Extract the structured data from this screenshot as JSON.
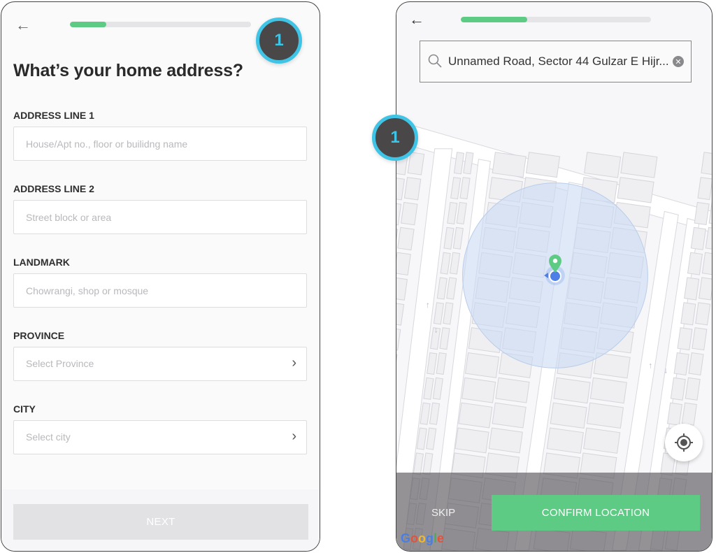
{
  "left_screen": {
    "progress_percent": 20,
    "title": "What’s your home address?",
    "fields": [
      {
        "label": "ADDRESS LINE 1",
        "placeholder": "House/Apt no., floor or builidng name",
        "type": "text"
      },
      {
        "label": "ADDRESS LINE 2",
        "placeholder": "Street block or area",
        "type": "text"
      },
      {
        "label": "LANDMARK",
        "placeholder": "Chowrangi, shop or mosque",
        "type": "text"
      },
      {
        "label": "PROVINCE",
        "placeholder": "Select Province",
        "type": "select"
      },
      {
        "label": "CITY",
        "placeholder": "Select city",
        "type": "select"
      }
    ],
    "next_label": "NEXT",
    "badge": "1"
  },
  "right_screen": {
    "progress_percent": 35,
    "search_value": "Unnamed Road, Sector 44 Gulzar E Hijr...",
    "skip_label": "SKIP",
    "confirm_label": "CONFIRM LOCATION",
    "map_attribution": "Google",
    "badge": "1"
  },
  "colors": {
    "accent_green": "#5ecb84",
    "badge_ring": "#3fc4e6",
    "badge_fill": "#4a4748",
    "location_blue": "#4d7fe6",
    "accuracy_circle": "#c9dbf3"
  }
}
